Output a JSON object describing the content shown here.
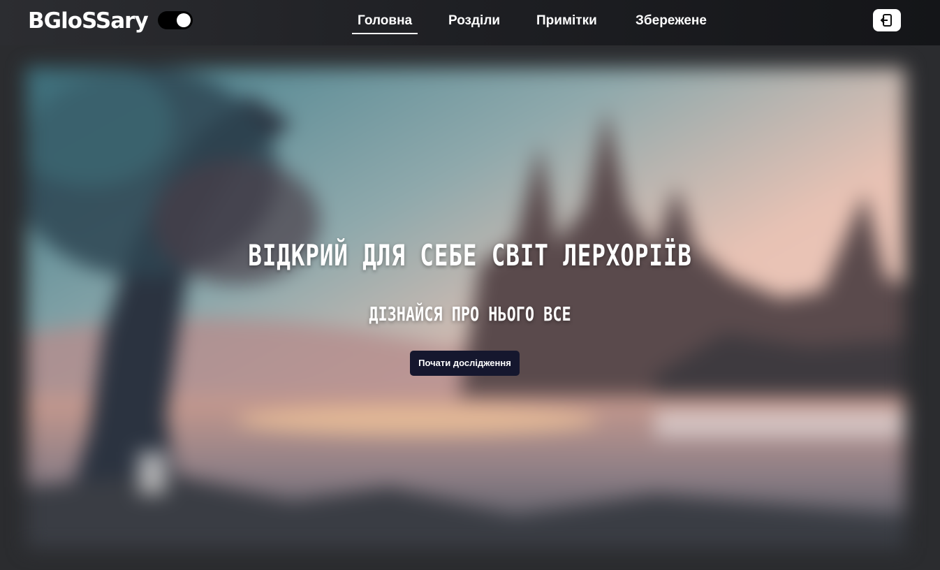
{
  "header": {
    "logo": "BGloSSary",
    "theme_toggle": {
      "state": "on"
    },
    "nav": [
      {
        "label": "Головна",
        "active": true
      },
      {
        "label": "Розділи",
        "active": false
      },
      {
        "label": "Примітки",
        "active": false
      },
      {
        "label": "Збережене",
        "active": false
      }
    ],
    "logout_icon": "logout-icon"
  },
  "hero": {
    "title": "ВІДКРИЙ ДЛЯ СЕБЕ СВІТ ЛЕРХОРІЇВ",
    "subtitle": "ДІЗНАЙСЯ ПРО НЬОГО ВСЕ",
    "cta_label": "Почати дослідження",
    "background_image": "blurred-fantasy-castle-landscape"
  },
  "colors": {
    "header_bg": "#1e1f23",
    "page_bg": "#2b2c2f",
    "cta_bg": "#15172e",
    "text": "#ffffff"
  }
}
